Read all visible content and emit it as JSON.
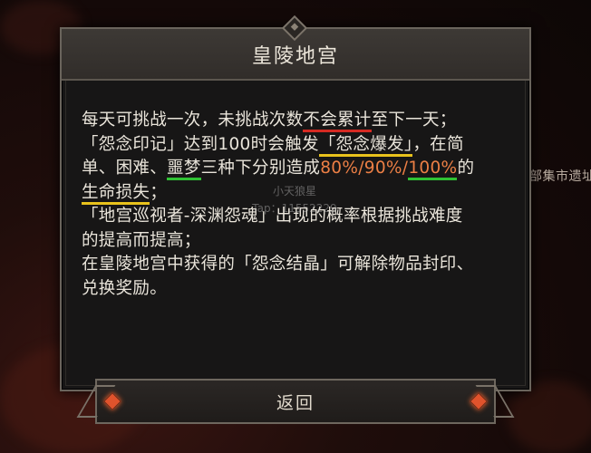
{
  "dialog": {
    "title": "皇陵地宫",
    "lines": [
      {
        "parts": [
          "每天可挑战一次，未挑战次数",
          "不会累计",
          "至下一天；"
        ]
      },
      {
        "parts": [
          "「怨念印记」达到100时会触发",
          "「怨念爆发」",
          "，在简"
        ]
      },
      {
        "parts": [
          "单、困难、",
          "噩梦",
          "三种下分别造成",
          "80%/90%/",
          "100%",
          "的"
        ]
      },
      {
        "parts": [
          "生命损失",
          "；"
        ]
      },
      {
        "parts": [
          "「地宫巡视者-深渊怨魂」出现的概率根据挑战难度"
        ]
      },
      {
        "parts": [
          "的提高而提高；"
        ]
      },
      {
        "parts": [
          "在皇陵地宫中获得的「怨念结晶」可解除物品封印、"
        ]
      },
      {
        "parts": [
          "兑换奖励。"
        ]
      }
    ]
  },
  "watermark": {
    "name": "小天狼星",
    "tap": "Tap：11552229"
  },
  "background": {
    "side_text": "部集市遗址"
  },
  "buttons": {
    "return_label": "返回"
  },
  "colors": {
    "underline_red": "#d52a22",
    "underline_yellow": "#e8c21c",
    "underline_green": "#2fc234",
    "highlight_orange": "#ec7f45"
  }
}
